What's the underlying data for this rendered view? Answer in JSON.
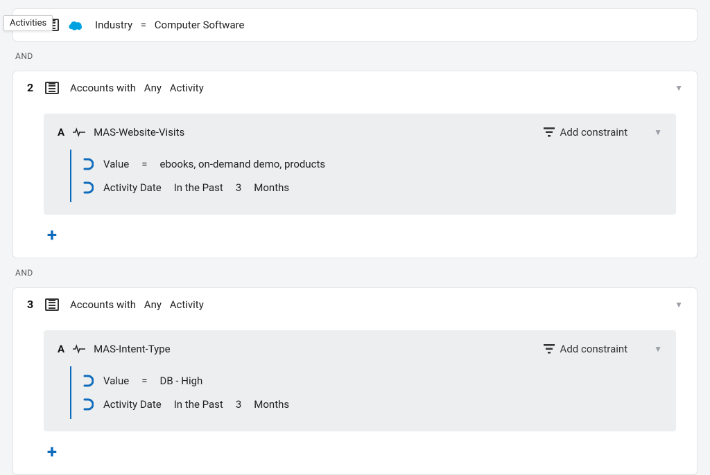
{
  "tooltip": "Activities",
  "connector": "AND",
  "rules": [
    {
      "number": "",
      "header": {
        "field": "Industry",
        "op": "=",
        "value": "Computer Software"
      }
    },
    {
      "number": "2",
      "header": {
        "prefix": "Accounts with",
        "quantifier": "Any",
        "noun": "Activity"
      },
      "activity": {
        "letter": "A",
        "name": "MAS-Website-Visits",
        "add_constraint_label": "Add constraint",
        "constraints": [
          {
            "field": "Value",
            "op": "=",
            "value": "ebooks, on-demand demo, products"
          },
          {
            "field": "Activity Date",
            "op": "In the Past",
            "num": "3",
            "unit": "Months"
          }
        ]
      }
    },
    {
      "number": "3",
      "header": {
        "prefix": "Accounts with",
        "quantifier": "Any",
        "noun": "Activity"
      },
      "activity": {
        "letter": "A",
        "name": "MAS-Intent-Type",
        "add_constraint_label": "Add constraint",
        "constraints": [
          {
            "field": "Value",
            "op": "=",
            "value": "DB - High"
          },
          {
            "field": "Activity Date",
            "op": "In the Past",
            "num": "3",
            "unit": "Months"
          }
        ]
      }
    }
  ]
}
